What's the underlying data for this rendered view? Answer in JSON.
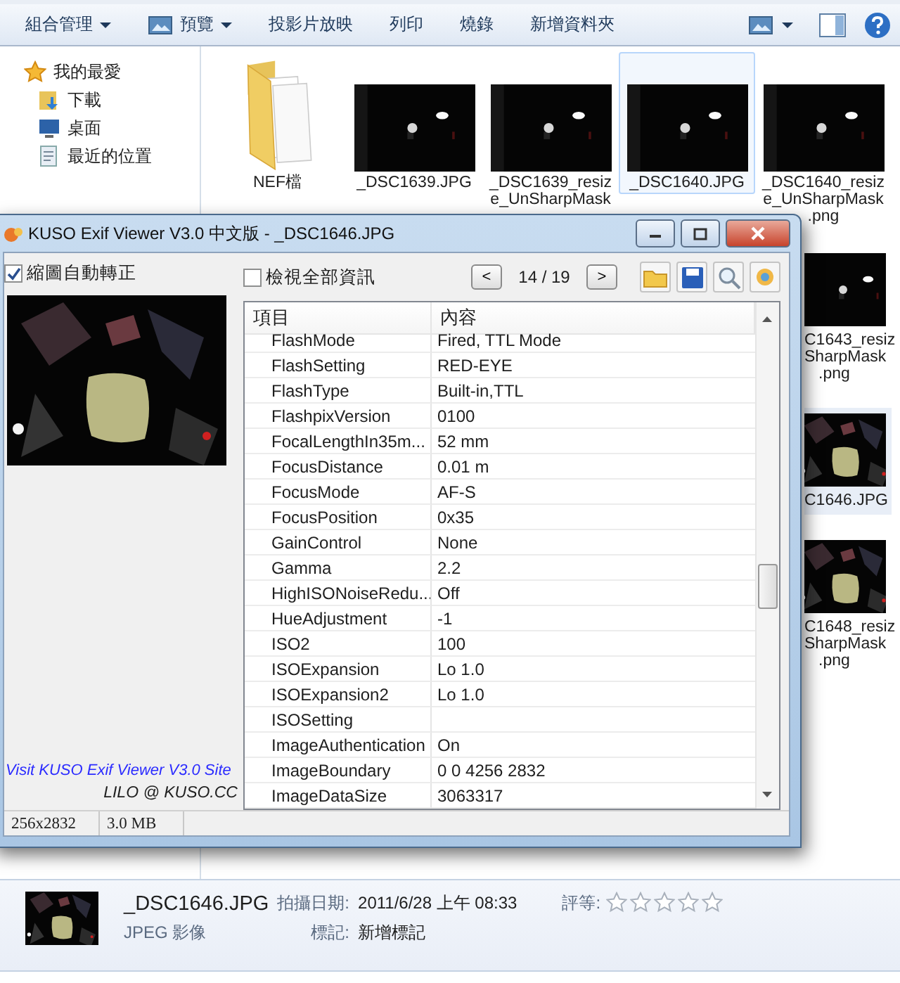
{
  "toolbar": {
    "items": [
      {
        "label": "組合管理",
        "kind": "menu"
      },
      {
        "label": "預覽",
        "kind": "preview"
      },
      {
        "label": "投影片放映",
        "kind": "button"
      },
      {
        "label": "列印",
        "kind": "button"
      },
      {
        "label": "燒錄",
        "kind": "button"
      },
      {
        "label": "新增資料夾",
        "kind": "button"
      }
    ]
  },
  "sidebar": {
    "items": [
      {
        "label": "我的最愛",
        "kind": "favorites"
      },
      {
        "label": "下載",
        "kind": "downloads"
      },
      {
        "label": "桌面",
        "kind": "desktop"
      },
      {
        "label": "最近的位置",
        "kind": "recent"
      }
    ]
  },
  "files": [
    {
      "kind": "folder",
      "lines": [
        "NEF檔"
      ],
      "selected": false
    },
    {
      "lines": [
        "_DSC1639.JPG"
      ],
      "selected": false
    },
    {
      "lines": [
        "_DSC1639_resiz",
        "e_UnSharpMask"
      ],
      "selected": false
    },
    {
      "lines": [
        "_DSC1640.JPG"
      ],
      "selected": true
    },
    {
      "lines": [
        "_DSC1640_resiz",
        "e_UnSharpMask",
        ".png"
      ],
      "selected": false
    }
  ],
  "files_right": [
    {
      "lines": [
        "C1643_resiz",
        "SharpMask",
        ".png"
      ],
      "selected": false
    },
    {
      "lines": [
        "C1646.JPG"
      ],
      "selected": true
    },
    {
      "lines": [
        "C1648_resiz",
        "SharpMask",
        ".png"
      ],
      "selected": false
    }
  ],
  "viewer": {
    "title": "KUSO Exif Viewer V3.0 中文版 - _DSC1646.JPG",
    "auto_rotate": {
      "label": "縮圖自動轉正",
      "checked": true
    },
    "show_all": {
      "label": "檢視全部資訊",
      "checked": false
    },
    "prev": "<",
    "next": ">",
    "counter": "14 / 19",
    "link": "Visit KUSO Exif Viewer V3.0 Site",
    "credit": "LILO @ KUSO.CC",
    "columns": [
      "項目",
      "內容"
    ],
    "rows": [
      [
        "FlashMode",
        "Fired, TTL Mode"
      ],
      [
        "FlashSetting",
        "RED-EYE"
      ],
      [
        "FlashType",
        "Built-in,TTL"
      ],
      [
        "FlashpixVersion",
        "0100"
      ],
      [
        "FocalLengthIn35m...",
        "52 mm"
      ],
      [
        "FocusDistance",
        "0.01 m"
      ],
      [
        "FocusMode",
        "AF-S"
      ],
      [
        "FocusPosition",
        "0x35"
      ],
      [
        "GainControl",
        "None"
      ],
      [
        "Gamma",
        "2.2"
      ],
      [
        "HighISONoiseRedu...",
        "Off"
      ],
      [
        "HueAdjustment",
        "-1"
      ],
      [
        "ISO2",
        "100"
      ],
      [
        "ISOExpansion",
        "Lo 1.0"
      ],
      [
        "ISOExpansion2",
        "Lo 1.0"
      ],
      [
        "ISOSetting",
        ""
      ],
      [
        "ImageAuthentication",
        "On"
      ],
      [
        "ImageBoundary",
        "0 0 4256 2832"
      ],
      [
        "ImageDataSize",
        "3063317"
      ]
    ],
    "status": [
      "256x2832",
      "3.0 MB"
    ]
  },
  "details": {
    "name": "_DSC1646.JPG",
    "type": "JPEG 影像",
    "date_label": "拍攝日期:",
    "date": "2011/6/28 上午 08:33",
    "tags_label": "標記:",
    "tags": "新增標記",
    "rating_label": "評等:",
    "stars": 0
  }
}
